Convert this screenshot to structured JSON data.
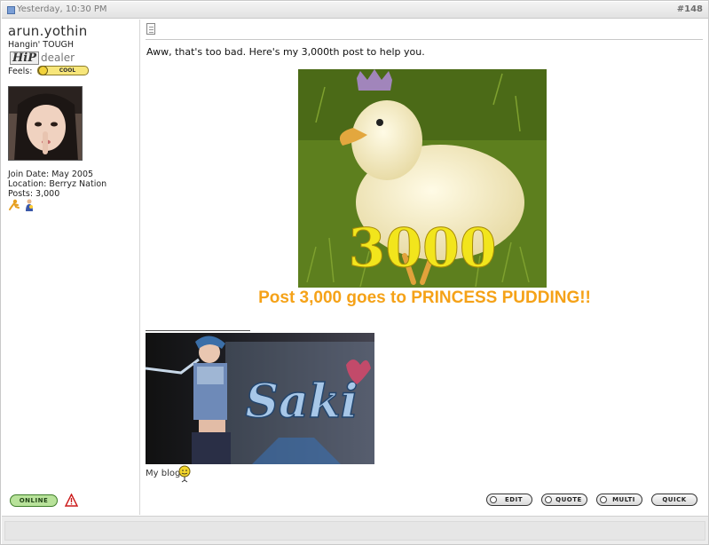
{
  "header": {
    "date": "Yesterday, 10:30 PM",
    "post_number": "#148",
    "post_icon": "post-icon"
  },
  "user": {
    "username": "arun.yothin",
    "title": "Hangin' TOUGH",
    "rank_hp": "HiP",
    "rank_dealer": "dealer",
    "feels_label": "Feels:",
    "mood": "COOL",
    "join_date": "Join Date: May 2005",
    "location": "Location: Berryz Nation",
    "posts": "Posts: 3,000",
    "online_label": "ONLINE"
  },
  "post": {
    "message": "Aww, that's too bad. Here's my 3,000th post to help you.",
    "image_caption": "3000",
    "headline": "Post 3,000 goes to PRINCESS PUDDING!!",
    "sig_image_text": "Saki",
    "blog_link": "My blog"
  },
  "buttons": {
    "edit": "EDIT",
    "quote": "QUOTE",
    "multi": "MULTI",
    "quick": "QUICK"
  },
  "colors": {
    "headline": "#f5a218",
    "duck_text": "#f2e51c",
    "online": "#b8e29a"
  }
}
